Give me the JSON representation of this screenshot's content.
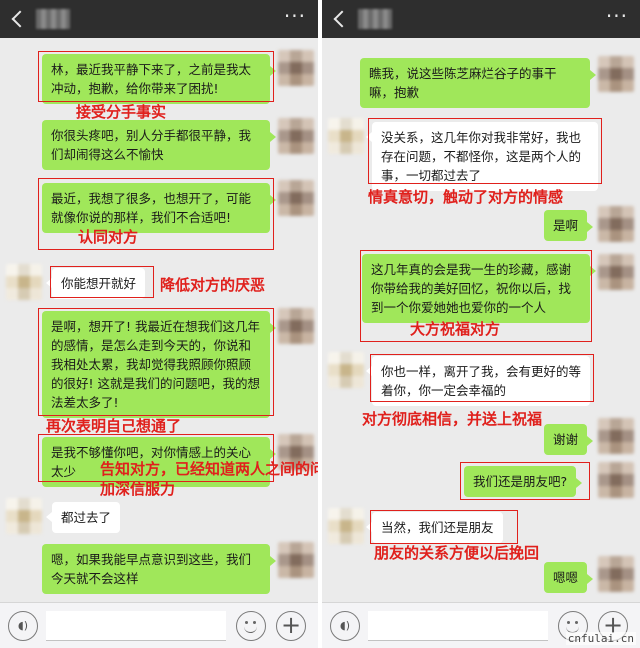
{
  "header": {
    "more_label": "···"
  },
  "left_panel": {
    "messages": [
      {
        "text": "林，最近我平静下来了，之前是我太冲动，抱歉，给你带来了困扰!"
      },
      {
        "text": "你很头疼吧，别人分手都很平静，我们却闹得这么不愉快"
      },
      {
        "text": "最近，我想了很多，也想开了，可能就像你说的那样，我们不合适吧!"
      },
      {
        "text": "你能想开就好"
      },
      {
        "text": "是啊，想开了! 我最近在想我们这几年的感情，是怎么走到今天的，你说和我相处太累，我却觉得我照顾你照顾的很好! 这就是我们的问题吧，我的想法差太多了!"
      },
      {
        "text": "是我不够懂你吧，对你情感上的关心太少"
      },
      {
        "text": "都过去了"
      },
      {
        "text": "嗯，如果我能早点意识到这些，我们今天就不会这样"
      }
    ],
    "annotations": [
      {
        "text": "接受分手事实"
      },
      {
        "text": "认同对方"
      },
      {
        "text": "降低对方的厌恶"
      },
      {
        "text": "再次表明自己想通了"
      },
      {
        "text": "告知对方，已经知道两人之间的问题"
      },
      {
        "text": "加深信服力"
      }
    ]
  },
  "right_panel": {
    "messages": [
      {
        "text": "瞧我，说这些陈芝麻烂谷子的事干嘛，抱歉"
      },
      {
        "text": "没关系，这几年你对我非常好，我也存在问题，不都怪你，这是两个人的事，一切都过去了"
      },
      {
        "text": "是啊"
      },
      {
        "text": "这几年真的会是我一生的珍藏，感谢你带给我的美好回忆，祝你以后，找到一个你爱她她也爱你的一个人"
      },
      {
        "text": "你也一样，离开了我，会有更好的等着你，你一定会幸福的"
      },
      {
        "text": "谢谢"
      },
      {
        "text": "我们还是朋友吧?"
      },
      {
        "text": "当然，我们还是朋友"
      },
      {
        "text": "嗯嗯"
      }
    ],
    "annotations": [
      {
        "text": "情真意切，触动了对方的情感"
      },
      {
        "text": "大方祝福对方"
      },
      {
        "text": "对方彻底相信，并送上祝福"
      },
      {
        "text": "朋友的关系方便以后挽回"
      }
    ]
  },
  "input_bar": {
    "voice_icon": "voice-icon",
    "emoji_icon": "emoji-icon",
    "plus_label": "+"
  },
  "watermark": "cnfulai.cn"
}
